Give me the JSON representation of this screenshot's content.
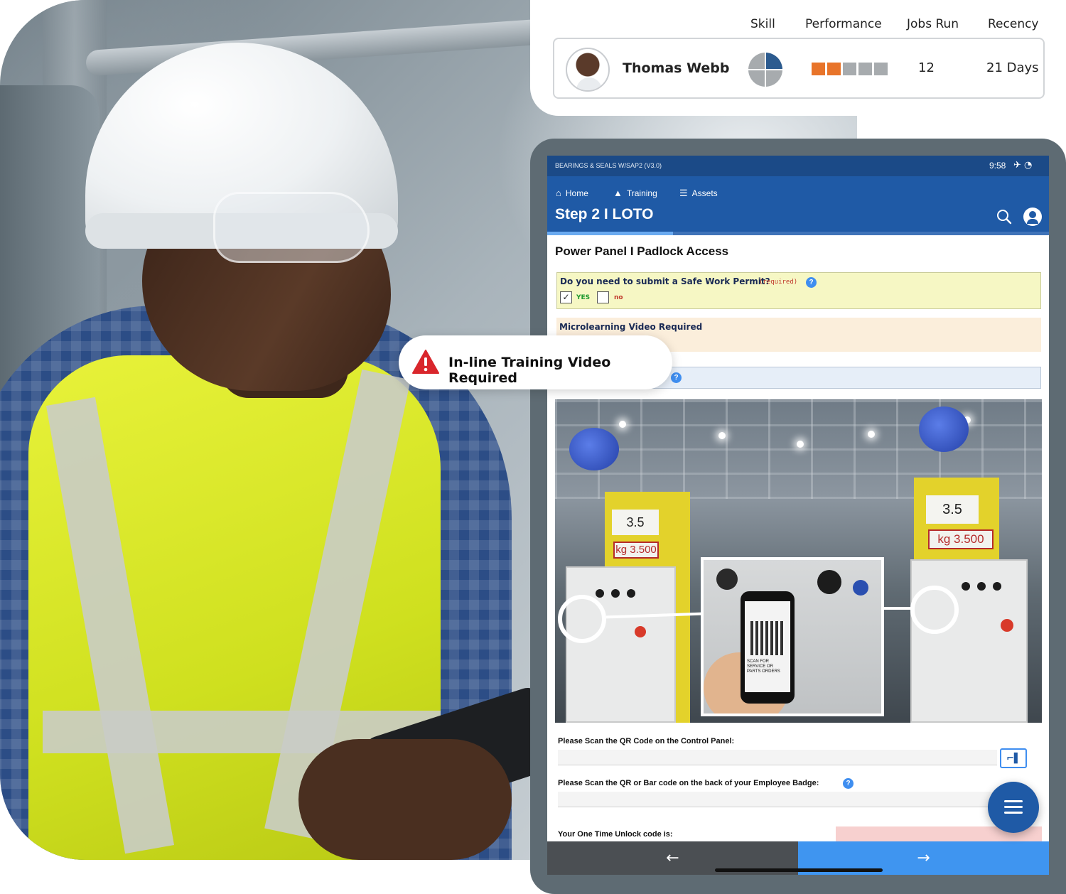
{
  "stats": {
    "headers": {
      "skill": "Skill",
      "performance": "Performance",
      "jobs_run": "Jobs Run",
      "recency": "Recency"
    },
    "person": {
      "name": "Thomas Webb",
      "jobs_run": "12",
      "recency": "21 Days"
    },
    "performance_level": {
      "filled": 2,
      "total": 5
    },
    "colors": {
      "accent": "#e8742a",
      "muted": "#a7abae",
      "skill_blue": "#2c5b8f"
    }
  },
  "tablet": {
    "status": {
      "title": "BEARINGS & SEALS W/SAP2 (V3.0)",
      "time": "9:58"
    },
    "nav": {
      "home": "Home",
      "training": "Training",
      "assets": "Assets",
      "step_title": "Step 2 I LOTO"
    },
    "progress_percent": 25,
    "section_title": "Power Panel I Padlock Access",
    "permit": {
      "question": "Do you need to submit a Safe Work Permit?",
      "required": "(required)",
      "yes": "YES",
      "no": "no",
      "help": "?"
    },
    "micro": {
      "title": "Microlearning Video Required"
    },
    "scene": {
      "cap_left": "3.5",
      "cap_right": "3.5",
      "plate_left": "kg 3.500",
      "plate_right": "kg 3.500",
      "phone_caption": "SCAN FOR SERVICE OR PARTS ORDERS"
    },
    "fields": {
      "qr_label": "Please Scan the QR Code on the Control Panel:",
      "badge_label": "Please Scan the QR or Bar code on the back of your Employee Badge:",
      "unlock_label": "Your One Time Unlock code is:"
    },
    "buttons": {
      "back": "←",
      "next": "→"
    },
    "colors": {
      "status_bar": "#1b4a87",
      "nav_bar": "#1f5aa6",
      "next_button": "#3f95f0",
      "back_button": "#4b4f53"
    }
  },
  "callout": {
    "text": "In-line Training Video Required"
  }
}
